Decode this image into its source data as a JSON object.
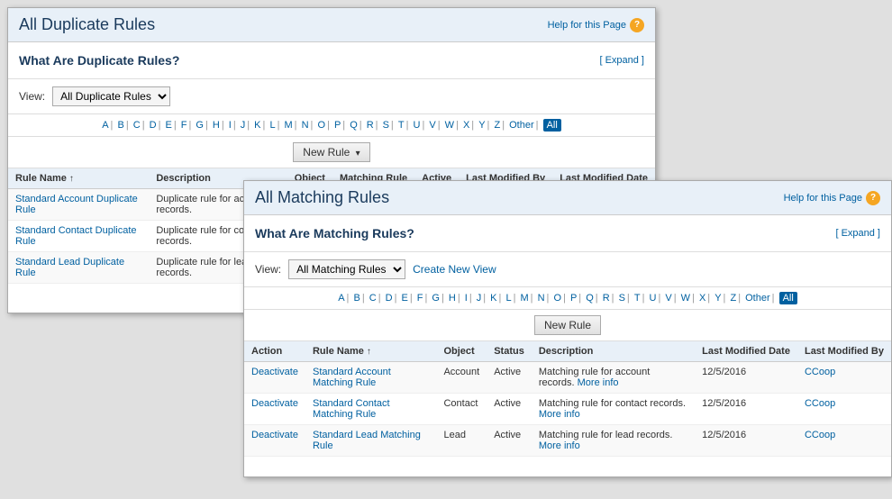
{
  "duplicate_panel": {
    "title": "All Duplicate Rules",
    "help_text": "Help for this Page",
    "info_title": "What Are Duplicate Rules?",
    "expand_label": "[ Expand ]",
    "view_label": "View:",
    "view_option": "All Duplicate Rules",
    "alpha_letters": [
      "A",
      "B",
      "C",
      "D",
      "E",
      "F",
      "G",
      "H",
      "I",
      "J",
      "K",
      "L",
      "M",
      "N",
      "O",
      "P",
      "Q",
      "R",
      "S",
      "T",
      "U",
      "V",
      "W",
      "X",
      "Y",
      "Z"
    ],
    "alpha_other": "Other",
    "alpha_all": "All",
    "new_rule_label": "New Rule",
    "table": {
      "columns": [
        "Rule Name",
        "Description",
        "Object",
        "Matching Rule",
        "Active",
        "Last Modified By",
        "Last Modified Date"
      ],
      "rows": [
        {
          "rule_name": "Standard Account Duplicate Rule",
          "description": "Duplicate rule for acc... records.",
          "object": "",
          "matching_rule": "",
          "active": "",
          "last_modified_by": "",
          "last_modified_date": ""
        },
        {
          "rule_name": "Standard Contact Duplicate Rule",
          "description": "Duplicate rule for cont... records.",
          "object": "",
          "matching_rule": "",
          "active": "",
          "last_modified_by": "",
          "last_modified_date": ""
        },
        {
          "rule_name": "Standard Lead Duplicate Rule",
          "description": "Duplicate rule for lead... records.",
          "object": "",
          "matching_rule": "",
          "active": "",
          "last_modified_by": "",
          "last_modified_date": ""
        }
      ]
    }
  },
  "matching_panel": {
    "title": "All Matching Rules",
    "help_text": "Help for this Page",
    "info_title": "What Are Matching Rules?",
    "expand_label": "[ Expand ]",
    "view_label": "View:",
    "view_option": "All Matching Rules",
    "create_new_view": "Create New View",
    "alpha_letters": [
      "A",
      "B",
      "C",
      "D",
      "E",
      "F",
      "G",
      "H",
      "I",
      "J",
      "K",
      "L",
      "M",
      "N",
      "O",
      "P",
      "Q",
      "R",
      "S",
      "T",
      "U",
      "V",
      "W",
      "X",
      "Y",
      "Z"
    ],
    "alpha_other": "Other",
    "alpha_all": "All",
    "new_rule_label": "New Rule",
    "table": {
      "columns": [
        "Action",
        "Rule Name",
        "Object",
        "Status",
        "Description",
        "Last Modified Date",
        "Last Modified By"
      ],
      "rows": [
        {
          "action": "Deactivate",
          "rule_name": "Standard Account Matching Rule",
          "object": "Account",
          "status": "Active",
          "description": "Matching rule for account records.",
          "more_info": "More info",
          "last_modified_date": "12/5/2016",
          "last_modified_by": "CCoop"
        },
        {
          "action": "Deactivate",
          "rule_name": "Standard Contact Matching Rule",
          "object": "Contact",
          "status": "Active",
          "description": "Matching rule for contact records.",
          "more_info": "More info",
          "last_modified_date": "12/5/2016",
          "last_modified_by": "CCoop"
        },
        {
          "action": "Deactivate",
          "rule_name": "Standard Lead Matching Rule",
          "object": "Lead",
          "status": "Active",
          "description": "Matching rule for lead records.",
          "more_info": "More info",
          "last_modified_date": "12/5/2016",
          "last_modified_by": "CCoop"
        }
      ]
    }
  }
}
